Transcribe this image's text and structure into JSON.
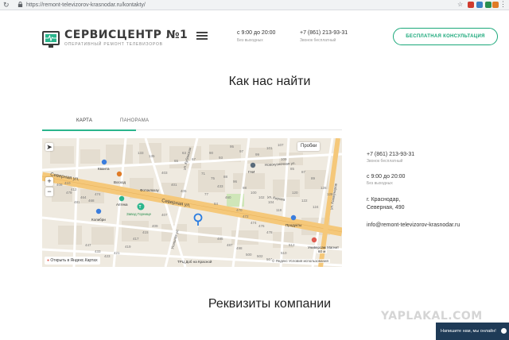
{
  "browser": {
    "url": "https://remont-televizorov-krasnodar.ru/kontakty/",
    "extension_colors": [
      "#cf3b2f",
      "#3b82c4",
      "#2a8f4f",
      "#e07b26"
    ]
  },
  "header": {
    "logo_title": "СЕРВИСЦЕНТР №1",
    "logo_subtitle": "оперативный ремонт телевизоров",
    "hours": "с 9:00 до 20:00",
    "hours_note": "Без выходных",
    "phone": "+7 (861) 213-93-31",
    "phone_note": "Звонок бесплатный",
    "consult_button": "Бесплатная консультация"
  },
  "page": {
    "title": "Как нас найти",
    "tabs": [
      {
        "label": "Карта",
        "active": true
      },
      {
        "label": "Панорама",
        "active": false
      }
    ],
    "requisites_title": "Реквизиты компании"
  },
  "map": {
    "traffic_button": "Пробки",
    "open_link": "Открыть в Яндекс.Картах",
    "copyright": "© Яндекс Условия использования",
    "scale_label": "60 м",
    "street_labels": {
      "severnaya_left": "Северная ул.",
      "severnaya_right": "Северная ул.",
      "kolkhoznaya": "Колхозная ул.",
      "ugolnaya": "Угольная ул.",
      "kubanskaya": "ул. Кубанская",
      "krasnoarmeyskaya": "ул. Красноармейская",
      "novokuznechnaya": "Новокузнечная ул.",
      "kirova": "ул. Кирова",
      "kommunarov": "ул. Коммунаров"
    },
    "poi": {
      "kvanta": "Кванта",
      "voskhod": "Восход",
      "photoclad": "Фотоклаззу",
      "apteka": "Аптека",
      "kolibri": "Колибри",
      "zavod": "Завод Горнице",
      "produkty": "Продукты",
      "gai": "ГАИ",
      "univermag": "Универсам Магнит",
      "krasnodar_center": "ТРЦ Доб на Красной"
    },
    "house_numbers": [
      "479",
      "481",
      "464",
      "468",
      "474",
      "408",
      "410",
      "412",
      "403",
      "401",
      "405",
      "407",
      "409",
      "415",
      "417",
      "419",
      "421",
      "423",
      "433",
      "447",
      "433",
      "460",
      "470",
      "472",
      "474",
      "476",
      "478",
      "485",
      "487",
      "498",
      "500",
      "502",
      "504",
      "510",
      "512",
      "90",
      "93",
      "95",
      "97",
      "99",
      "101",
      "107",
      "109",
      "85",
      "87",
      "89",
      "63",
      "65",
      "67",
      "71",
      "75",
      "77",
      "84",
      "88",
      "96",
      "98",
      "100",
      "102",
      "104",
      "118",
      "120",
      "122",
      "124",
      "126",
      "128",
      "133",
      "135"
    ],
    "colors": {
      "background": "#efeae0",
      "main_road": "#f5c87a",
      "minor_road": "#ffffff",
      "marker": "#2b7de1",
      "park": "#cfe6b8"
    }
  },
  "contacts": {
    "phone": "+7 (861) 213-93-31",
    "phone_note": "Звонок бесплатный",
    "hours": "с 9:00 до 20:00",
    "hours_note": "Без выходных",
    "city": "г. Краснодар,",
    "address": "Северная, 490",
    "email": "info@remont-televizorov-krasnodar.ru"
  },
  "overlay": {
    "watermark": "YAPLAKAL.COM",
    "chat": "Напишите нам, мы онлайн!"
  }
}
